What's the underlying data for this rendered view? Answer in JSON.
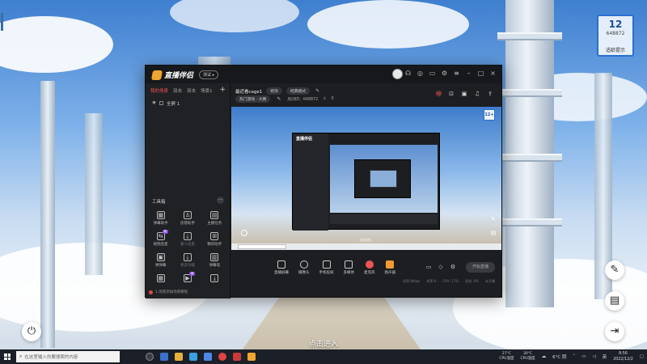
{
  "desktop": {
    "enter_text": "点击进入",
    "widget": {
      "big": "12",
      "num": "648872",
      "label": "适龄提示"
    }
  },
  "app": {
    "name": "直播伴侣",
    "version_badge": "测试 ▸",
    "left_tabs": [
      "我的场景",
      "双击",
      "双击",
      "场景1"
    ],
    "scene_item": "全屏 1",
    "toolbox_title": "工具箱",
    "toolbox_more": "···",
    "tools": [
      {
        "label": "弹幕助手",
        "icon": "▦"
      },
      {
        "label": "房管助手",
        "icon": "♙"
      },
      {
        "label": "主播任务",
        "icon": "▤"
      },
      {
        "label": "视频连麦",
        "icon": "⇆",
        "badge": "新"
      },
      {
        "label": "嘉人连麦",
        "icon": "⤓",
        "dim": true
      },
      {
        "label": "精华助手",
        "icon": "⊞"
      },
      {
        "label": "弹弹幕",
        "icon": "▣"
      },
      {
        "label": "更多功能",
        "icon": "⤓",
        "dim": true
      },
      {
        "label": "弹幕墙",
        "icon": "▥"
      },
      {
        "label": "",
        "icon": "▦"
      },
      {
        "label": "",
        "icon": "▶",
        "badge": "新"
      },
      {
        "label": "",
        "icon": "⤓"
      }
    ],
    "notice": "1.场景添加场景教程",
    "room": {
      "title": "最近看cage1",
      "tag1": "修改",
      "tag2": "经典模式",
      "category": "热门游戏 · 大赛",
      "room_id_label": "房间ID：648872",
      "online": "0"
    },
    "preview": {
      "enter": "点击进入",
      "badge": "12+"
    },
    "bottom_tools": [
      {
        "label": "直播屏幕",
        "style": ""
      },
      {
        "label": "摄像头",
        "style": ""
      },
      {
        "label": "手机投屏",
        "style": ""
      },
      {
        "label": "多媒体",
        "style": ""
      },
      {
        "label": "麦克风",
        "style": "red"
      },
      {
        "label": "扬声器",
        "style": "orange"
      }
    ],
    "start_button": "开始直播",
    "status": [
      "码率:0kbps",
      "帧率:0",
      "CPU: 17%",
      "丢帧: 0%",
      "未开播"
    ]
  },
  "taskbar": {
    "search_placeholder": "在这里输入你要搜索的内容",
    "weather1": {
      "temp": "27°C",
      "label": "CPU温度"
    },
    "weather2": {
      "temp": "30°C",
      "label": "CPU温度"
    },
    "weather3": "6°C 阴",
    "lang": "英",
    "time": "8:56",
    "date": "2022/12/2"
  },
  "colors": {
    "accent_red": "#f05454",
    "accent_orange": "#f39b30",
    "app_bg": "#1d1e22"
  }
}
